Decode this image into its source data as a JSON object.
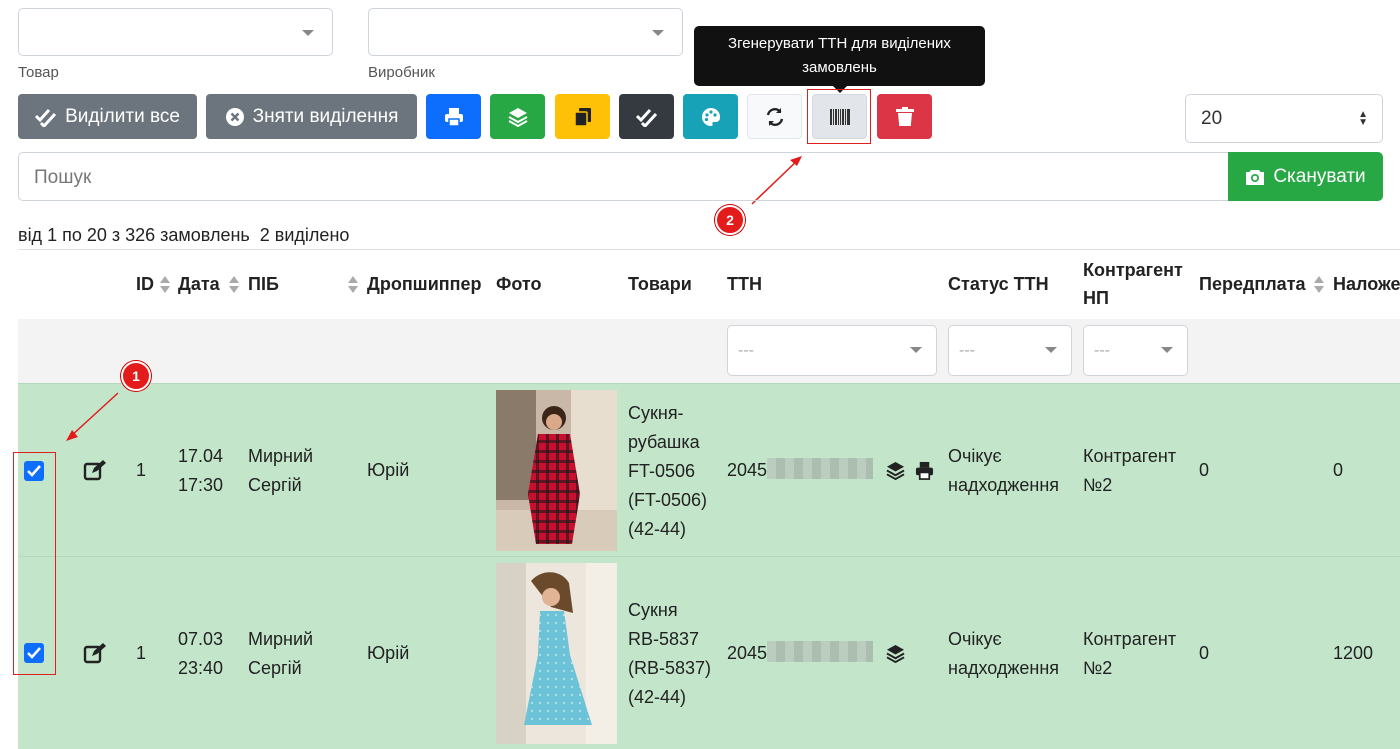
{
  "filters": {
    "product_label": "Товар",
    "manufacturer_label": "Виробник"
  },
  "toolbar": {
    "select_all_label": "Виділити все",
    "deselect_label": "Зняти виділення",
    "tooltip": "Згенерувати ТТН для виділених замовлень",
    "colors": {
      "secondary": "#6c757d",
      "primary": "#0d6efd",
      "success": "#28a745",
      "warning": "#ffc107",
      "dark": "#343a40",
      "info": "#17a2b8",
      "danger": "#dc3545"
    },
    "icons": [
      "print-icon",
      "layers-icon",
      "copy-icon",
      "double-check-icon",
      "palette-icon",
      "refresh-icon",
      "barcode-icon",
      "trash-icon"
    ]
  },
  "page_size": {
    "value": "20"
  },
  "search": {
    "placeholder": "Пошук",
    "scan_label": "Сканувати"
  },
  "summary": {
    "range": "від 1 по 20 з 326 замовлень",
    "selected": "2 виділено"
  },
  "table": {
    "headers": {
      "id": "ID",
      "date": "Дата",
      "name": "ПІБ",
      "dropshipper": "Дропшиппер",
      "photo": "Фото",
      "goods": "Товари",
      "ttn": "ТТН",
      "ttn_status": "Статус ТТН",
      "counterparty_l1": "Контрагент",
      "counterparty_l2": "НП",
      "prepay": "Передплата",
      "cod": "Наложе"
    },
    "filter_placeholder": "---",
    "rows": [
      {
        "id": "1",
        "date": "17.04",
        "time": "17:30",
        "name_l1": "Мирний",
        "name_l2": "Сергій",
        "dropshipper": "Юрій",
        "goods": [
          "Сукня-",
          "рубашка",
          "FT-0506",
          "(FT-0506)",
          "(42-44)"
        ],
        "ttn_prefix": "2045",
        "status_l1": "Очікує",
        "status_l2": "надходження",
        "cp_l1": "Контрагент",
        "cp_l2": "№2",
        "prepay": "0",
        "cod": "0"
      },
      {
        "id": "1",
        "date": "07.03",
        "time": "23:40",
        "name_l1": "Мирний",
        "name_l2": "Сергій",
        "dropshipper": "Юрій",
        "goods": [
          "Сукня",
          "RB-5837",
          "(RB-5837)",
          "(42-44)"
        ],
        "ttn_prefix": "2045",
        "status_l1": "Очікує",
        "status_l2": "надходження",
        "cp_l1": "Контрагент",
        "cp_l2": "№2",
        "prepay": "0",
        "cod": "1200"
      }
    ]
  },
  "annotations": {
    "step1": "1",
    "step2": "2"
  }
}
